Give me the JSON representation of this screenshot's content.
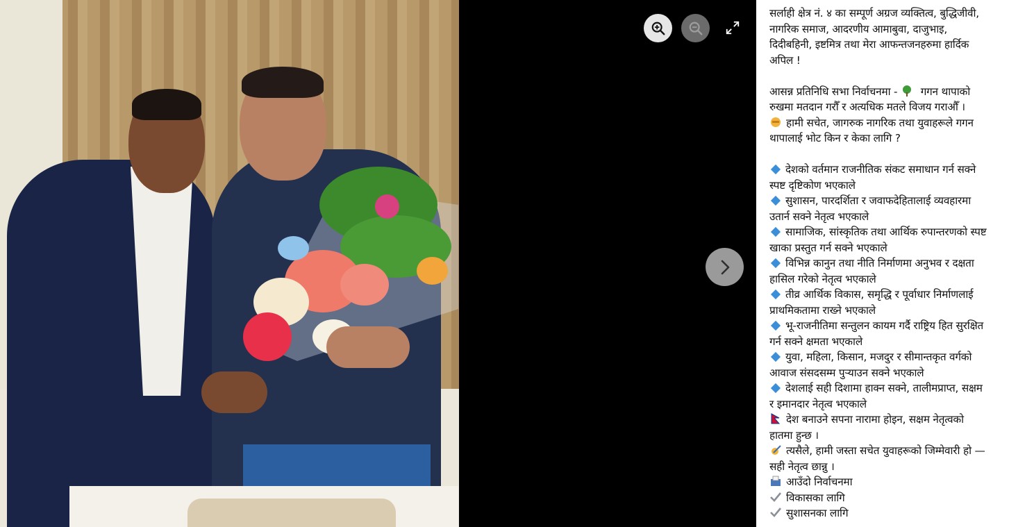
{
  "viewer": {
    "zoom_in_icon": "zoom-in-icon",
    "zoom_out_icon": "zoom-out-icon",
    "fullscreen_icon": "expand-icon",
    "next_icon": "chevron-right-icon",
    "photo_alt": "Two men posing with a flower bouquet"
  },
  "caption": {
    "intro": [
      "सर्लाही क्षेत्र नं. ४ का सम्पूर्ण अग्रज व्यक्तित्व, बुद्धिजीवी,",
      "नागरिक समाज, आदरणीय आमाबुवा, दाजुभाइ,",
      "दिदीबहिनी, इष्टमित्र तथा मेरा आफन्तजनहरुमा हार्दिक",
      "अपिल !"
    ],
    "p1_a": "आसन्न प्रतिनिधि सभा निर्वाचनमा - ",
    "p1_b": " गगन थापाको",
    "p1_c": "रुखमा मतदान गरौँ र अत्यधिक मतले विजय गराऔँ ।",
    "p2_a": "हामी सचेत, जागरुक नागरिक तथा युवाहरूले गगन",
    "p2_b": "थापालाई भोट किन र केका लागि ?",
    "bullets": [
      {
        "l1": "देशको वर्तमान राजनीतिक संकट समाधान गर्न सक्ने",
        "l2": "स्पष्ट दृष्टिकोण भएकाले"
      },
      {
        "l1": "सुशासन, पारदर्शिता र जवाफदेहितालाई व्यवहारमा",
        "l2": "उतार्न सक्ने नेतृत्व भएकाले"
      },
      {
        "l1": "सामाजिक, सांस्कृतिक तथा आर्थिक रुपान्तरणको स्पष्ट",
        "l2": "खाका प्रस्तुत गर्न सक्ने भएकाले"
      },
      {
        "l1": "विभिन्न कानुन तथा नीति निर्माणमा अनुभव र दक्षता",
        "l2": "हासिल गरेको नेतृत्व भएकाले"
      },
      {
        "l1": "तीव्र आर्थिक विकास, समृद्धि र पूर्वाधार निर्माणलाई",
        "l2": "प्राथमिकतामा राख्ने भएकाले"
      },
      {
        "l1": "भू-राजनीतिमा सन्तुलन कायम गर्दै राष्ट्रिय हित सुरक्षित",
        "l2": "गर्न सक्ने क्षमता भएकाले"
      },
      {
        "l1": "युवा, महिला, किसान, मजदुर र सीमान्तकृत वर्गको",
        "l2": "आवाज संसदसम्म पुर्‍याउन सक्ने भएकाले"
      },
      {
        "l1": "देशलाई सही दिशामा हाक्न सक्ने, तालीमप्राप्त, सक्षम",
        "l2": "र इमानदार नेतृत्व भएकाले"
      }
    ],
    "flag_a": "देश बनाउने सपना नारामा होइन, सक्षम नेतृत्वको",
    "flag_b": "हातमा हुन्छ ।",
    "write_a": "त्यसैले, हामी जस्ता सचेत युवाहरूको जिम्मेवारी हो —",
    "write_b": "सही नेतृत्व छान्नु ।",
    "ballot": "आउँदो निर्वाचनमा",
    "checks": [
      "विकासका लागि",
      "सुशासनका लागि"
    ]
  },
  "colors": {
    "accent_blue": "#3b8fd9",
    "viewer_bg": "#000000",
    "caption_bg": "#ffffff"
  }
}
